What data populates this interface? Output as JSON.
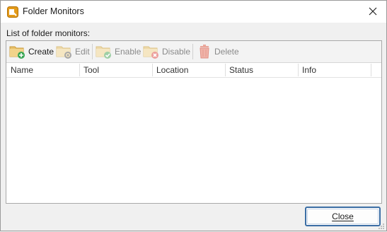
{
  "window": {
    "title": "Folder Monitors",
    "icon": "app-icon"
  },
  "list_label": "List of folder monitors:",
  "toolbar": {
    "create": "Create",
    "edit": "Edit",
    "enable": "Enable",
    "disable": "Disable",
    "delete": "Delete"
  },
  "columns": [
    "Name",
    "Tool",
    "Location",
    "Status",
    "Info"
  ],
  "rows": [],
  "footer": {
    "close_label": "Close"
  },
  "colors": {
    "accent_border": "#3b6ea5",
    "folder": "#e8c06a",
    "plus_green": "#3aa655",
    "x_red": "#d9534f",
    "trash": "#e89a8f"
  }
}
